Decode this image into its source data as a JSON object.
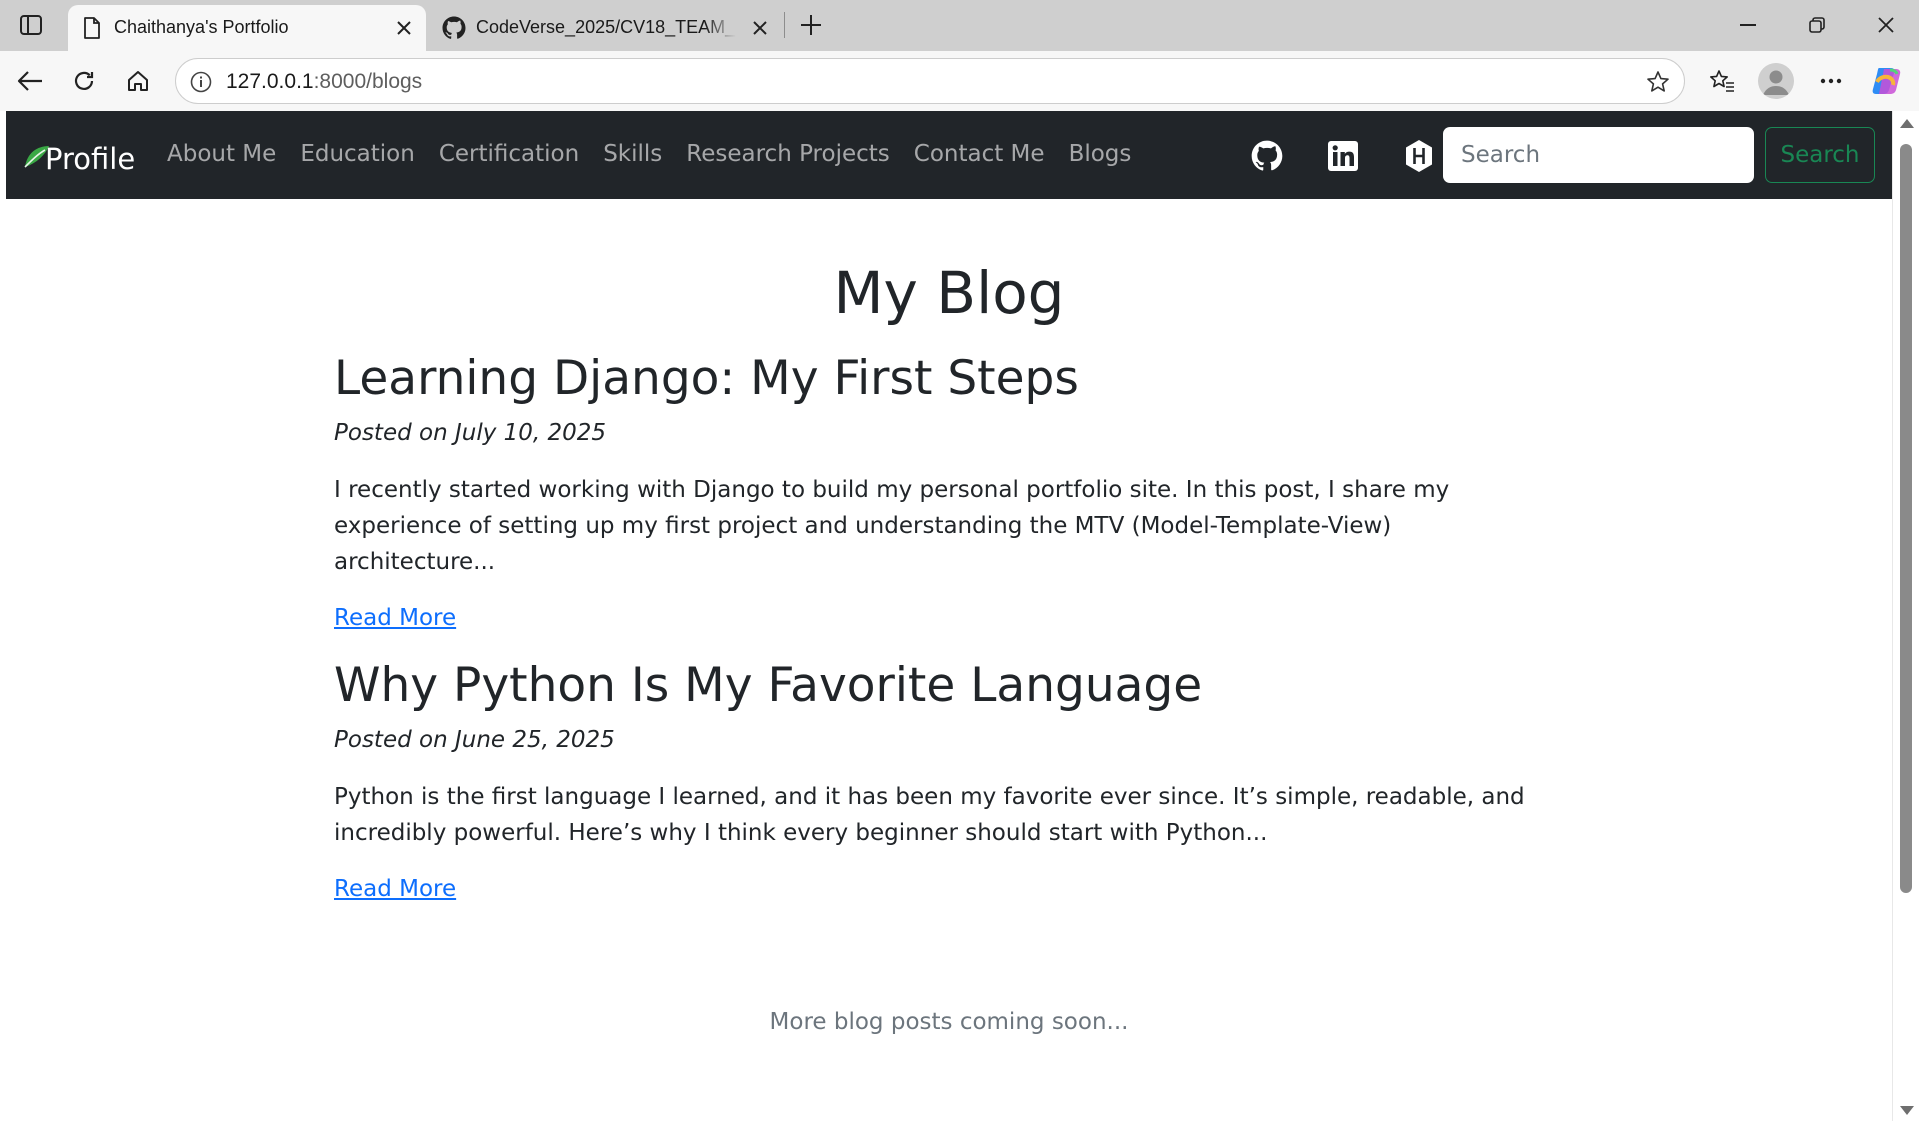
{
  "browser": {
    "tabs": [
      {
        "title": "Chaithanya's Portfolio",
        "active": true,
        "icon": "page-icon"
      },
      {
        "title": "CodeVerse_2025/CV18_TEAM_ID/",
        "active": false,
        "icon": "github-icon"
      }
    ],
    "url_host": "127.0.0.1",
    "url_path": ":8000/blogs"
  },
  "navbar": {
    "brand": "Profile",
    "links": [
      "About Me",
      "Education",
      "Certification",
      "Skills",
      "Research Projects",
      "Contact Me",
      "Blogs"
    ],
    "search_placeholder": "Search",
    "search_button": "Search",
    "social_icons": [
      "github-icon",
      "linkedin-icon",
      "hackerrank-icon"
    ]
  },
  "page": {
    "title": "My Blog",
    "posts": [
      {
        "title": "Learning Django: My First Steps",
        "date": "Posted on July 10, 2025",
        "excerpt": "I recently started working with Django to build my personal portfolio site. In this post, I share my experience of setting up my first project and understanding the MTV (Model-Template-View) architecture...",
        "link": "Read More"
      },
      {
        "title": "Why Python Is My Favorite Language",
        "date": "Posted on June 25, 2025",
        "excerpt": "Python is the first language I learned, and it has been my favorite ever since. It’s simple, readable, and incredibly powerful. Here’s why I think every beginner should start with Python...",
        "link": "Read More"
      }
    ],
    "footer_note": "More blog posts coming soon..."
  },
  "colors": {
    "navbar_bg": "#212529",
    "link": "#0d6efd",
    "success": "#198754",
    "muted": "#6c757d"
  }
}
